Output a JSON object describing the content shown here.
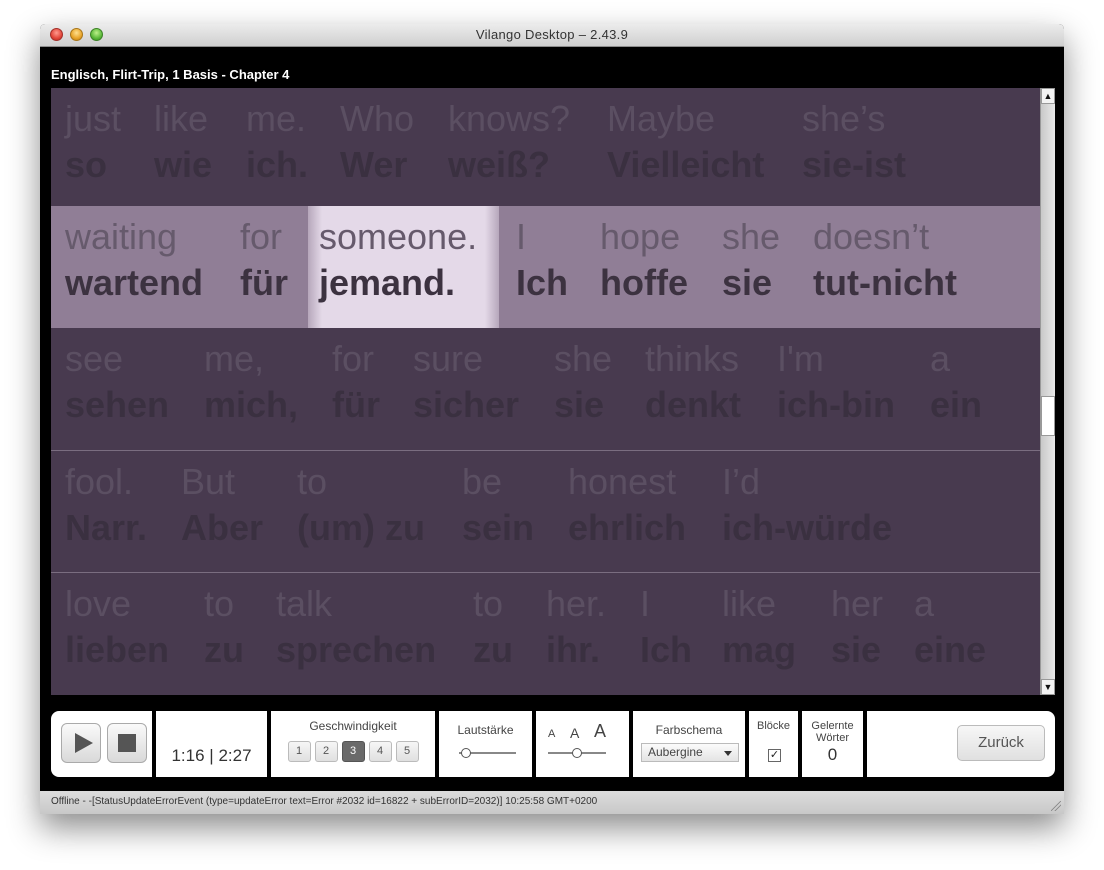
{
  "window": {
    "title": "Vilango Desktop – 2.43.9"
  },
  "header": {
    "title": "Englisch, Flirt-Trip, 1 Basis - Chapter 4"
  },
  "reader": {
    "lines": [
      [
        {
          "src": "just",
          "tr": "so"
        },
        {
          "src": "like",
          "tr": "wie"
        },
        {
          "src": "me.",
          "tr": "ich."
        },
        {
          "src": "Who",
          "tr": "Wer"
        },
        {
          "src": "knows?",
          "tr": "weiß?"
        },
        {
          "src": "Maybe",
          "tr": "Vielleicht"
        },
        {
          "src": "she’s",
          "tr": "sie-ist"
        }
      ],
      [
        {
          "src": "waiting",
          "tr": "wartend"
        },
        {
          "src": "for",
          "tr": "für"
        },
        {
          "src": "someone.",
          "tr": "jemand."
        },
        {
          "src": "I",
          "tr": "Ich"
        },
        {
          "src": "hope",
          "tr": "hoffe"
        },
        {
          "src": "she",
          "tr": "sie"
        },
        {
          "src": "doesn’t",
          "tr": "tut-nicht"
        }
      ],
      [
        {
          "src": "see",
          "tr": "sehen"
        },
        {
          "src": "me,",
          "tr": "mich,"
        },
        {
          "src": "for",
          "tr": "für"
        },
        {
          "src": "sure",
          "tr": "sicher"
        },
        {
          "src": "she",
          "tr": "sie"
        },
        {
          "src": "thinks",
          "tr": "denkt"
        },
        {
          "src": "I'm",
          "tr": "ich-bin"
        },
        {
          "src": "a",
          "tr": "ein"
        }
      ],
      [
        {
          "src": "fool.",
          "tr": "Narr."
        },
        {
          "src": "But",
          "tr": "Aber"
        },
        {
          "src": "to",
          "tr": "(um) zu"
        },
        {
          "src": "be",
          "tr": "sein"
        },
        {
          "src": "honest",
          "tr": "ehrlich"
        },
        {
          "src": "I’d",
          "tr": "ich-würde"
        }
      ],
      [
        {
          "src": "love",
          "tr": "lieben"
        },
        {
          "src": "to",
          "tr": "zu"
        },
        {
          "src": "talk",
          "tr": "sprechen"
        },
        {
          "src": "to",
          "tr": "zu"
        },
        {
          "src": "her.",
          "tr": "ihr."
        },
        {
          "src": "I",
          "tr": "Ich"
        },
        {
          "src": "like",
          "tr": "mag"
        },
        {
          "src": "her",
          "tr": "sie"
        },
        {
          "src": "a",
          "tr": "eine"
        }
      ]
    ]
  },
  "scrollbar": {
    "up_glyph": "▲",
    "down_glyph": "▼"
  },
  "controls": {
    "time_current": "1:16",
    "time_separator": "|",
    "time_total": "2:27",
    "speed_label": "Geschwindigkeit",
    "speeds": [
      "1",
      "2",
      "3",
      "4",
      "5"
    ],
    "speed_selected": "3",
    "volume_label": "Lautstärke",
    "font_small": "A",
    "font_medium": "A",
    "font_large": "A",
    "color_scheme_label": "Farbschema",
    "color_scheme_value": "Aubergine",
    "blocks_label": "Blöcke",
    "blocks_check": "✓",
    "learned_label_1": "Gelernte",
    "learned_label_2": "Wörter",
    "learned_count": "0",
    "back_label": "Zurück"
  },
  "status": {
    "text": "Offline - -[StatusUpdateErrorEvent (type=updateError text=Error #2032 id=16822 + subErrorID=2032)] 10:25:58 GMT+0200"
  },
  "colors": {
    "reader_bg": "#483a4f",
    "active_line_bg": "#907e96",
    "highlight": "#e4d9e8"
  }
}
